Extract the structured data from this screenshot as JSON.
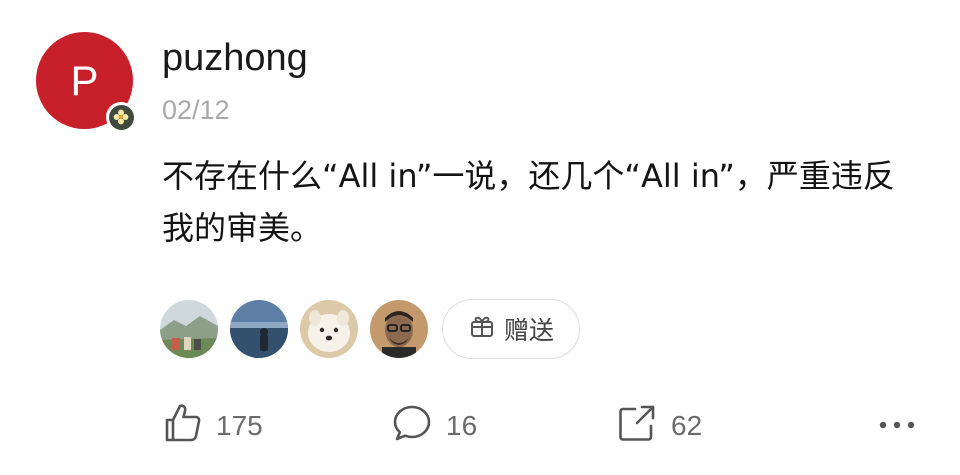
{
  "post": {
    "avatar_letter": "P",
    "avatar_color": "#c8202b",
    "badge_icon": "flower-badge-icon",
    "username": "puzhong",
    "date": "02/12",
    "text": "不存在什么“All in”一说，还几个“All in”，严重违反我的审美。"
  },
  "gifts": {
    "givers": [
      {
        "name": "mountain-landscape-avatar"
      },
      {
        "name": "seaside-person-avatar"
      },
      {
        "name": "white-dog-avatar"
      },
      {
        "name": "man-with-glasses-avatar"
      }
    ],
    "button_label": "赠送",
    "button_icon": "gift-icon"
  },
  "actions": {
    "like": {
      "icon": "thumbs-up-icon",
      "count": "175"
    },
    "comment": {
      "icon": "speech-bubble-icon",
      "count": "16"
    },
    "share": {
      "icon": "share-icon",
      "count": "62"
    },
    "more": {
      "icon": "more-dots-icon"
    }
  }
}
